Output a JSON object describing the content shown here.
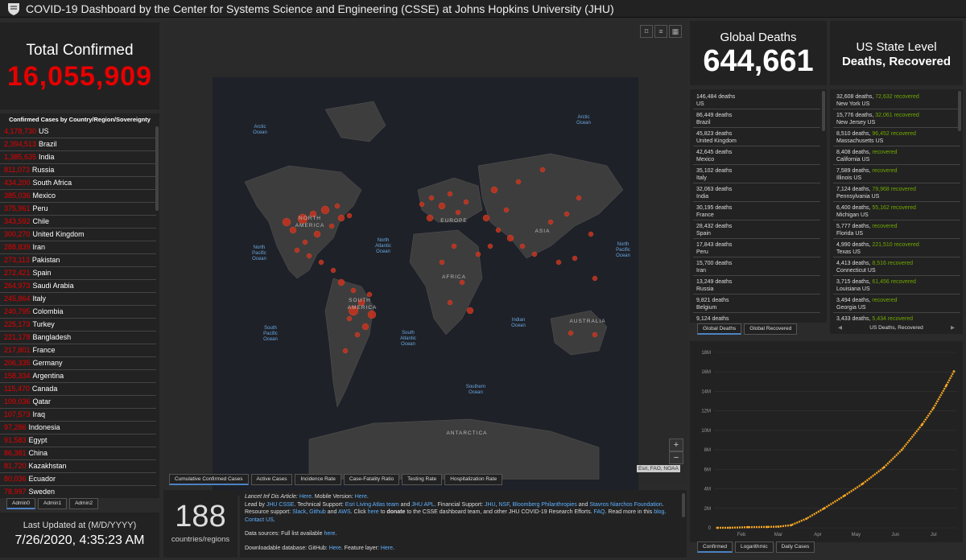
{
  "header": {
    "title": "COVID-19 Dashboard by the Center for Systems Science and Engineering (CSSE) at Johns Hopkins University (JHU)"
  },
  "total": {
    "label": "Total Confirmed",
    "value": "16,055,909"
  },
  "country_list": {
    "heading": "Confirmed Cases by Country/Region/Sovereignty",
    "items": [
      {
        "n": "4,178,730",
        "c": "US"
      },
      {
        "n": "2,394,513",
        "c": "Brazil"
      },
      {
        "n": "1,385,635",
        "c": "India"
      },
      {
        "n": "811,073",
        "c": "Russia"
      },
      {
        "n": "434,200",
        "c": "South Africa"
      },
      {
        "n": "385,036",
        "c": "Mexico"
      },
      {
        "n": "375,961",
        "c": "Peru"
      },
      {
        "n": "343,592",
        "c": "Chile"
      },
      {
        "n": "300,270",
        "c": "United Kingdom"
      },
      {
        "n": "288,839",
        "c": "Iran"
      },
      {
        "n": "273,113",
        "c": "Pakistan"
      },
      {
        "n": "272,421",
        "c": "Spain"
      },
      {
        "n": "264,973",
        "c": "Saudi Arabia"
      },
      {
        "n": "245,864",
        "c": "Italy"
      },
      {
        "n": "240,795",
        "c": "Colombia"
      },
      {
        "n": "225,173",
        "c": "Turkey"
      },
      {
        "n": "221,178",
        "c": "Bangladesh"
      },
      {
        "n": "217,801",
        "c": "France"
      },
      {
        "n": "206,335",
        "c": "Germany"
      },
      {
        "n": "158,334",
        "c": "Argentina"
      },
      {
        "n": "115,470",
        "c": "Canada"
      },
      {
        "n": "109,036",
        "c": "Qatar"
      },
      {
        "n": "107,573",
        "c": "Iraq"
      },
      {
        "n": "97,286",
        "c": "Indonesia"
      },
      {
        "n": "91,583",
        "c": "Egypt"
      },
      {
        "n": "86,381",
        "c": "China"
      },
      {
        "n": "81,720",
        "c": "Kazakhstan"
      },
      {
        "n": "80,036",
        "c": "Ecuador"
      },
      {
        "n": "78,997",
        "c": "Sweden"
      }
    ]
  },
  "admin_tabs": [
    "Admin0",
    "Admin1",
    "Admin2"
  ],
  "updated": {
    "label": "Last Updated at (M/D/YYYY)",
    "value": "7/26/2020, 4:35:23 AM"
  },
  "map": {
    "labels": {
      "arctic1": "Arctic",
      "arctic1b": "Ocean",
      "arctic2": "Arctic",
      "arctic2b": "Ocean",
      "na": "NORTH",
      "nab": "AMERICA",
      "europe": "EUROPE",
      "asia": "ASIA",
      "africa": "AFRICA",
      "sa": "SOUTH",
      "sab": "AMERICA",
      "australia": "AUSTRALIA",
      "antarctica": "ANTARCTICA",
      "npo1": "North",
      "npo1b": "Pacific",
      "npo1c": "Ocean",
      "nao": "North",
      "naob": "Atlantic",
      "naoc": "Ocean",
      "npo2": "North",
      "npo2b": "Pacific",
      "npo2c": "Ocean",
      "spo": "South",
      "spob": "Pacific",
      "spoc": "Ocean",
      "sao": "South",
      "saob": "Atlantic",
      "saoc": "Ocean",
      "io": "Indian",
      "iob": "Ocean",
      "so": "Southern",
      "sob": "Ocean"
    },
    "attribution": "Esri, FAO, NOAA",
    "tabs": [
      "Cumulative Confirmed Cases",
      "Active Cases",
      "Incidence Rate",
      "Case-Fatality Ratio",
      "Testing Rate",
      "Hospitalization Rate"
    ],
    "zoom_in": "+",
    "zoom_out": "−"
  },
  "countries": {
    "value": "188",
    "label": "countries/regions"
  },
  "info": {
    "p1_a": "Lancet Inf Dis Article: ",
    "p1_b": "Here",
    "p1_c": ". Mobile Version: ",
    "p1_d": "Here",
    "p1_e": ".",
    "p1_f": "Lead by ",
    "p1_g": "JHU CSSE",
    "p1_h": ". Technical Support: ",
    "p1_i": "Esri Living Atlas team",
    "p1_j": " and ",
    "p1_k": "JHU APL",
    "p1_l": ". Financial Support: ",
    "p1_m": "JHU",
    "p1_n": ", ",
    "p1_o": "NSF",
    "p1_p": ", ",
    "p1_q": "Bloomberg Philanthropies",
    "p1_r": " and ",
    "p1_s": "Stavros Niarchos Foundation",
    "p1_t": ". Resource support: ",
    "p1_u": "Slack",
    "p1_v": ", ",
    "p1_w": "Github",
    "p1_x": " and ",
    "p1_y": "AWS",
    "p1_z": ". Click ",
    "p1_aa": "here",
    "p1_ab": " to ",
    "p1_ac": "donate",
    "p1_ad": " to the CSSE dashboard team, and other JHU COVID-19 Research Efforts. ",
    "p1_ae": "FAQ",
    "p1_af": ". Read more in this ",
    "p1_ag": "blog",
    "p1_ah": ". ",
    "p1_ai": "Contact US",
    "p1_aj": ".",
    "p2_a": "Data sources: Full list available ",
    "p2_b": "here",
    "p2_c": ".",
    "p3_a": "Downloadable database: GitHub: ",
    "p3_b": "Here",
    "p3_c": ". Feature layer: ",
    "p3_d": "Here",
    "p3_e": "."
  },
  "global_deaths": {
    "label": "Global Deaths",
    "value": "644,661",
    "items": [
      {
        "n": "146,484 deaths",
        "c": "US"
      },
      {
        "n": "86,449 deaths",
        "c": "Brazil"
      },
      {
        "n": "45,823 deaths",
        "c": "United Kingdom"
      },
      {
        "n": "42,645 deaths",
        "c": "Mexico"
      },
      {
        "n": "35,102 deaths",
        "c": "Italy"
      },
      {
        "n": "32,063 deaths",
        "c": "India"
      },
      {
        "n": "30,195 deaths",
        "c": "France"
      },
      {
        "n": "28,432 deaths",
        "c": "Spain"
      },
      {
        "n": "17,843 deaths",
        "c": "Peru"
      },
      {
        "n": "15,700 deaths",
        "c": "Iran"
      },
      {
        "n": "13,249 deaths",
        "c": "Russia"
      },
      {
        "n": "9,821 deaths",
        "c": "Belgium"
      },
      {
        "n": "9,124 deaths",
        "c": ""
      }
    ],
    "tabs": [
      "Global Deaths",
      "Global Recovered"
    ]
  },
  "us_state": {
    "label": "US State Level",
    "value": "Deaths, Recovered",
    "items": [
      {
        "d": "32,608 deaths, ",
        "r": "72,632",
        "rl": " recovered",
        "s": "New York US"
      },
      {
        "d": "15,776 deaths, ",
        "r": "32,061",
        "rl": " recovered",
        "s": "New Jersey US"
      },
      {
        "d": "8,510 deaths, ",
        "r": "96,452",
        "rl": " recovered",
        "s": "Massachusetts US"
      },
      {
        "d": "8,408 deaths, ",
        "r": "",
        "rl": " recovered",
        "s": "California US"
      },
      {
        "d": "7,589 deaths, ",
        "r": "",
        "rl": " recovered",
        "s": "Illinois US"
      },
      {
        "d": "7,124 deaths, ",
        "r": "79,968",
        "rl": " recovered",
        "s": "Pennsylvania US"
      },
      {
        "d": "6,400 deaths, ",
        "r": "55,162",
        "rl": " recovered",
        "s": "Michigan US"
      },
      {
        "d": "5,777 deaths, ",
        "r": "",
        "rl": " recovered",
        "s": "Florida US"
      },
      {
        "d": "4,990 deaths, ",
        "r": "221,510",
        "rl": " recovered",
        "s": "Texas US"
      },
      {
        "d": "4,413 deaths, ",
        "r": "8,516",
        "rl": " recovered",
        "s": "Connecticut US"
      },
      {
        "d": "3,715 deaths, ",
        "r": "61,456",
        "rl": " recovered",
        "s": "Louisiana US"
      },
      {
        "d": "3,494 deaths, ",
        "r": "",
        "rl": " recovered",
        "s": "Georgia US"
      },
      {
        "d": "3,433 deaths, ",
        "r": "5,434",
        "rl": " recovered",
        "s": ""
      }
    ],
    "nav_label": "US Deaths, Recovered",
    "prev": "◀",
    "next": "▶"
  },
  "chart_data": {
    "type": "line",
    "x": [
      "Jan 22",
      "Feb 1",
      "Feb 15",
      "Mar 1",
      "Mar 10",
      "Mar 20",
      "Apr 1",
      "Apr 15",
      "May 1",
      "May 15",
      "Jun 1",
      "Jun 15",
      "Jul 1",
      "Jul 10",
      "Jul 20",
      "Jul 26"
    ],
    "series": [
      {
        "values": [
          0.00055,
          0.012,
          0.069,
          0.088,
          0.12,
          0.27,
          0.93,
          2.0,
          3.3,
          4.5,
          6.2,
          8.0,
          10.6,
          12.3,
          14.6,
          16.06
        ]
      }
    ],
    "y_unit": "M",
    "yticks": [
      "0",
      "2M",
      "4M",
      "6M",
      "8M",
      "10M",
      "12M",
      "14M",
      "16M",
      "18M"
    ],
    "xticks": [
      "Feb",
      "Mar",
      "Apr",
      "May",
      "Jun",
      "Jul"
    ],
    "ylim": [
      0,
      18
    ],
    "color": "#f5a623",
    "tabs": [
      "Confirmed",
      "Logarithmic",
      "Daily Cases"
    ]
  },
  "colors": {
    "accent_red": "#e60000",
    "recovered_green": "#70a800",
    "link_blue": "#5eb0ff"
  }
}
